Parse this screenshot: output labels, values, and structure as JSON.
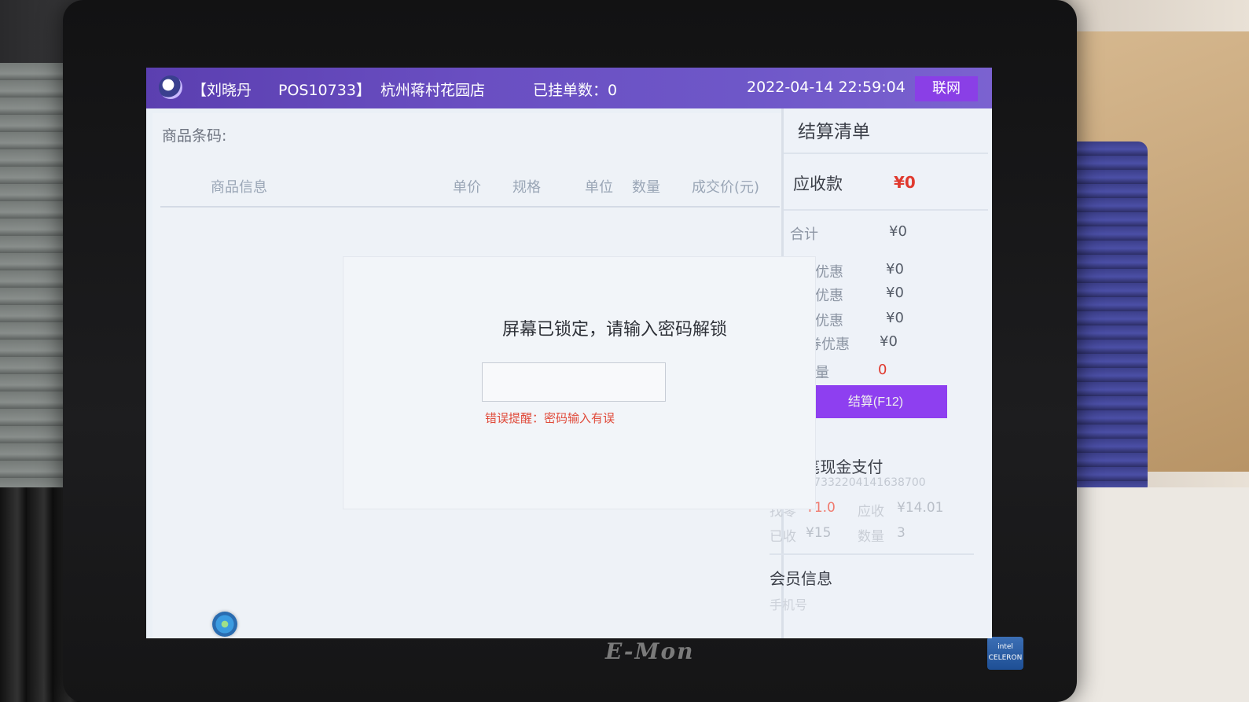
{
  "topbar": {
    "cashier": "【刘晓丹",
    "terminal": "POS10733】",
    "store": "杭州蒋村花园店",
    "suspended_orders": "已挂单数：0",
    "datetime": "2022-04-14 22:59:04",
    "network_label": "联网"
  },
  "barcode": {
    "label": "商品条码:"
  },
  "table_headers": {
    "info": "商品信息",
    "price": "单价",
    "spec": "规格",
    "unit": "单位",
    "qty": "数量",
    "deal_price": "成交价(元)"
  },
  "lock": {
    "message": "屏幕已锁定，请输入密码解锁",
    "error": "错误提醒：密码输入有误"
  },
  "settlement": {
    "title": "结算清单",
    "due_label": "应收款",
    "due_value": "¥0",
    "total_label": "合计",
    "total_value": "¥0",
    "rows": [
      {
        "label": "优惠",
        "value": "¥0"
      },
      {
        "label": "优惠",
        "value": "¥0"
      },
      {
        "label": "优惠",
        "value": "¥0"
      },
      {
        "label": "券优惠",
        "value": "¥0"
      },
      {
        "label": "量",
        "value": "0"
      }
    ],
    "checkout_label": "结算(F12)"
  },
  "last_payment": {
    "title": "__ 笔现金支付",
    "order_no": "POS107332204141638700",
    "change_label": "找零",
    "change_value": "¥1.0",
    "receivable_label": "应收",
    "receivable_value": "¥14.01",
    "received_label": "已收",
    "received_value": "¥15",
    "qty_label": "数量",
    "qty_value": "3"
  },
  "member": {
    "title": "会员信息",
    "phone_label": "手机号"
  },
  "colors": {
    "accent": "#8e3ff0",
    "topbar": "#6a4fc2",
    "error": "#e04a3a"
  }
}
